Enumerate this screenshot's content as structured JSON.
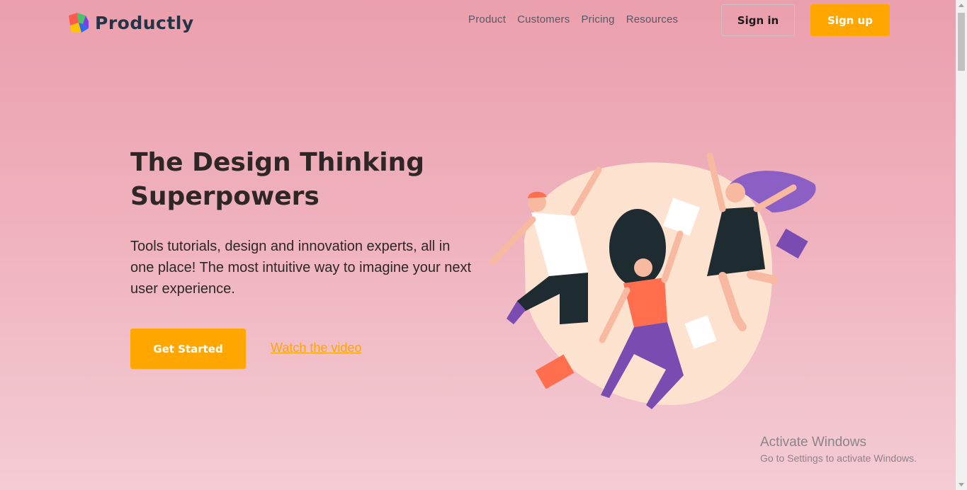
{
  "brand": {
    "name": "Productly",
    "primary": "#ffa600",
    "text_dark": "#243447"
  },
  "nav": {
    "items": [
      {
        "label": "Product"
      },
      {
        "label": "Customers"
      },
      {
        "label": "Pricing"
      },
      {
        "label": "Resources"
      }
    ]
  },
  "auth": {
    "signin_label": "Sign in",
    "signup_label": "Sign up"
  },
  "hero": {
    "title": "The Design Thinking Superpowers",
    "description": "Tools tutorials, design and innovation experts, all in one place! The most intuitive way to imagine your next user experience.",
    "cta_label": "Get Started",
    "video_link_label": "Watch the video"
  },
  "illustration": {
    "icon": "jumping-people-illustration"
  },
  "os_watermark": {
    "title": "Activate Windows",
    "subtitle": "Go to Settings to activate Windows."
  }
}
